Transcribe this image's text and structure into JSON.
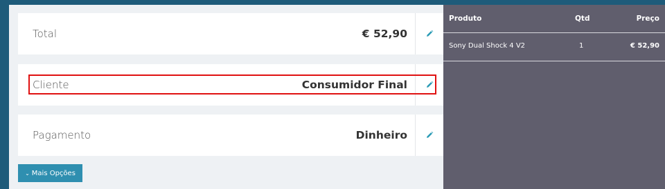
{
  "summary": {
    "total": {
      "label": "Total",
      "value": "€ 52,90"
    },
    "cliente": {
      "label": "Cliente",
      "value": "Consumidor Final"
    },
    "pagamento": {
      "label": "Pagamento",
      "value": "Dinheiro"
    }
  },
  "more_options_label": "Mais Opções",
  "cart": {
    "columns": {
      "product": "Produto",
      "qty": "Qtd",
      "price": "Preço"
    },
    "rows": [
      {
        "product": "Sony Dual Shock 4 V2",
        "qty": "1",
        "price": "€ 52,90"
      }
    ]
  },
  "colors": {
    "background": "#1e5b7a",
    "panel": "#eef1f4",
    "cart_panel": "#605e6d",
    "button": "#2f8fb0",
    "edit_icon": "#2a9bb5",
    "highlight": "#e01010"
  },
  "icons": {
    "edit": "pencil-icon",
    "more": "chevron-down-icon"
  }
}
